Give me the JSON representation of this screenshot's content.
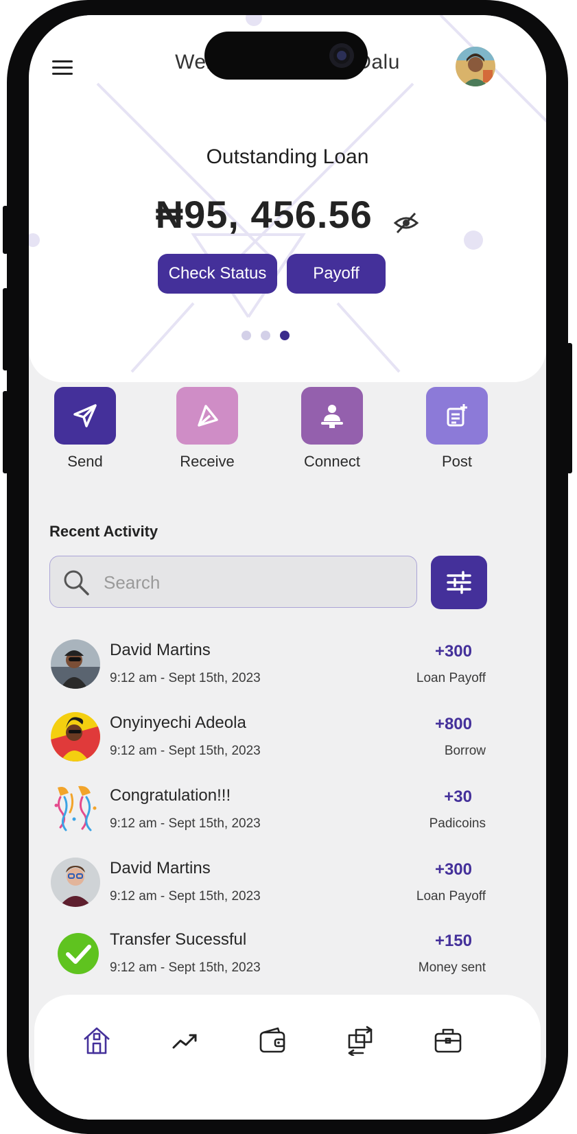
{
  "header": {
    "welcome_left": "Welc",
    "welcome_right": "Dalu"
  },
  "hero": {
    "title": "Outstanding Loan",
    "amount": "₦95, 456.56",
    "check_status_label": "Check Status",
    "payoff_label": "Payoff",
    "carousel": {
      "total": 3,
      "active": 3
    }
  },
  "actions": [
    {
      "label": "Send",
      "icon": "send-icon",
      "color": "#44309a"
    },
    {
      "label": "Receive",
      "icon": "receive-icon",
      "color": "#cf8dc6"
    },
    {
      "label": "Connect",
      "icon": "connect-icon",
      "color": "#9460ad"
    },
    {
      "label": "Post",
      "icon": "post-icon",
      "color": "#8c7ad8"
    }
  ],
  "recent": {
    "title": "Recent Activity",
    "search_placeholder": "Search",
    "items": [
      {
        "name": "David Martins",
        "time": "9:12 am - Sept 15th, 2023",
        "amount": "+300",
        "type": "Loan Payoff",
        "avatar": "cyclist-avatar"
      },
      {
        "name": "Onyinyechi Adeola",
        "time": "9:12 am - Sept 15th, 2023",
        "amount": "+800",
        "type": "Borrow",
        "avatar": "woman-yellow-avatar"
      },
      {
        "name": "Congratulation!!!",
        "time": "9:12 am - Sept 15th, 2023",
        "amount": "+30",
        "type": "Padicoins",
        "avatar": "confetti-icon"
      },
      {
        "name": "David Martins",
        "time": "9:12 am - Sept 15th, 2023",
        "amount": "+300",
        "type": "Loan Payoff",
        "avatar": "man-glasses-avatar"
      },
      {
        "name": "Transfer Sucessful",
        "time": "9:12 am - Sept 15th, 2023",
        "amount": "+150",
        "type": "Money sent",
        "avatar": "check-circle-icon"
      }
    ]
  },
  "nav": [
    {
      "icon": "home-icon",
      "active": true
    },
    {
      "icon": "trend-icon",
      "active": false
    },
    {
      "icon": "wallet-icon",
      "active": false
    },
    {
      "icon": "transfer-icon",
      "active": false
    },
    {
      "icon": "briefcase-icon",
      "active": false
    }
  ],
  "colors": {
    "primary": "#44309a",
    "dot_inactive": "#d3d0e8",
    "success": "#5fc31f",
    "background": "#f0f0f1"
  }
}
